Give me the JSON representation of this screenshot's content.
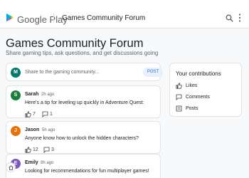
{
  "header": {
    "brand": "Google Play",
    "title": "Games Community Forum",
    "icons": [
      "google-play-logo",
      "search-icon",
      "more-vert-icon"
    ]
  },
  "page": {
    "title": "Games Community Forum",
    "subtitle": "Share gaming tips, ask questions, and get discussions going"
  },
  "compose": {
    "avatar": "M",
    "placeholder": "Share to the gaming community...",
    "post_label": "POST"
  },
  "posts": [
    {
      "initial": "S",
      "author": "Sarah",
      "time": "2h ago",
      "body": "Here's a tip for leveling up quickly in Adventure Quest:",
      "likes": "7",
      "comments": "1",
      "avatar_color": "#188038"
    },
    {
      "initial": "J",
      "author": "Jason",
      "time": "5h ago",
      "body": "Anyone know how to unlock the hidden characters?",
      "likes": "12",
      "comments": "3",
      "avatar_color": "#e8710a"
    },
    {
      "initial": "E",
      "author": "Emily",
      "time": "8h ago",
      "body": "Looking for recommendations for fun multiplayer games!",
      "avatar_color": "#7e57c2"
    }
  ],
  "sidebar": {
    "title": "Your contributions",
    "items": [
      {
        "label": "Likes",
        "icon": "thumb-up-icon"
      },
      {
        "label": "Comments",
        "icon": "comment-icon"
      },
      {
        "label": "Posts",
        "icon": "posts-icon"
      }
    ]
  },
  "colors": {
    "accent": "#1a73e8",
    "compose_avatar": "#00796b"
  }
}
